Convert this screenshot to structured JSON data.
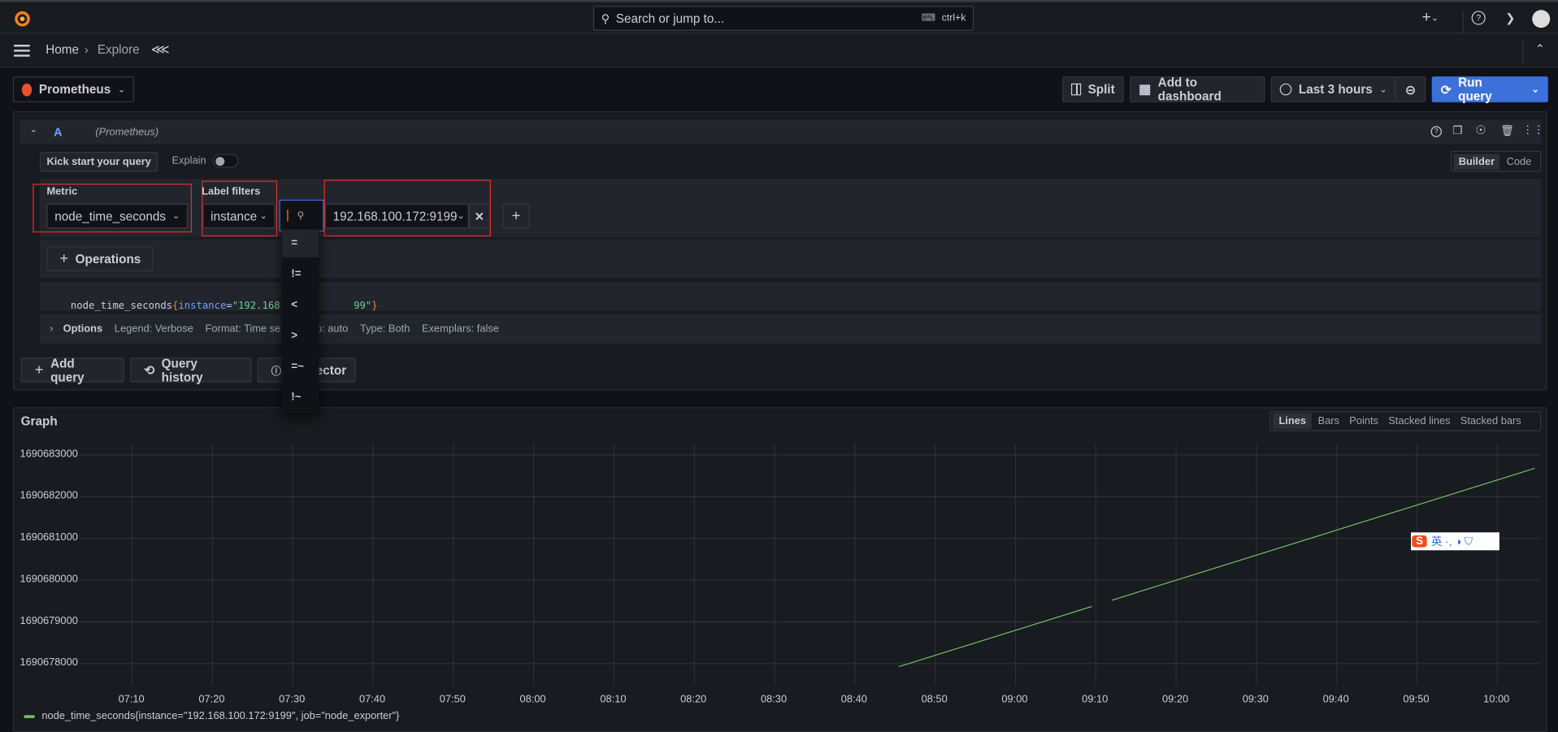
{
  "topbar": {
    "search_placeholder": "Search or jump to...",
    "search_shortcut": "ctrl+k"
  },
  "breadcrumb": {
    "home": "Home",
    "current": "Explore"
  },
  "toolbar": {
    "datasource": "Prometheus",
    "split": "Split",
    "add_to_dashboard": "Add to dashboard",
    "time_range": "Last 3 hours",
    "run_query": "Run query",
    "accent": "#3d71d9"
  },
  "query": {
    "ref_id": "A",
    "datasource_label": "(Prometheus)",
    "kick_start": "Kick start your query",
    "explain": "Explain",
    "explain_on": false,
    "modes": [
      "Builder",
      "Code"
    ],
    "active_mode": "Builder",
    "metric_label": "Metric",
    "metric_value": "node_time_seconds",
    "label_filters_label": "Label filters",
    "label_key": "instance",
    "label_value": "192.168.100.172:9199",
    "operations": "Operations",
    "preview": {
      "metric": "node_time_seconds",
      "open": "{",
      "key": "instance",
      "eq": "=",
      "value": "\"192.168.100.",
      "value_end": "99\"",
      "close": "}"
    },
    "options": {
      "title": "Options",
      "legend": "Legend: Verbose",
      "format": "Format: Time se",
      "step": "Step: auto",
      "type": "Type: Both",
      "exemplars": "Exemplars: false"
    }
  },
  "operator_dropdown": {
    "items": [
      "=",
      "!=",
      "<",
      ">",
      "=~",
      "!~"
    ],
    "highlighted": "="
  },
  "actions": {
    "add_query": "Add query",
    "query_history": "Query history",
    "inspector": "ector"
  },
  "graph": {
    "title": "Graph",
    "types": [
      "Lines",
      "Bars",
      "Points",
      "Stacked lines",
      "Stacked bars"
    ],
    "active_type": "Lines"
  },
  "chart_data": {
    "type": "line",
    "x_ticks": [
      "07:10",
      "07:20",
      "07:30",
      "07:40",
      "07:50",
      "08:00",
      "08:10",
      "08:20",
      "08:30",
      "08:40",
      "08:50",
      "09:00",
      "09:10",
      "09:20",
      "09:30",
      "09:40",
      "09:50",
      "10:00"
    ],
    "y_ticks": [
      "1690683000",
      "1690682000",
      "1690681000",
      "1690680000",
      "1690679000",
      "1690678000"
    ],
    "xlim": [
      "07:03:26",
      "10:05:20"
    ],
    "ylim": [
      1690677600,
      1690683120
    ],
    "grid": true,
    "legend_placement": "bottom-left",
    "series": [
      {
        "name": "node_time_seconds{instance=\"192.168.100.172:9199\", job=\"node_exporter\"}",
        "color": "#73bf69",
        "segments": [
          [
            [
              "08:45:29",
              1690677929
            ],
            [
              "09:09:30",
              1690679370
            ]
          ],
          [
            [
              "09:12:00",
              1690679520
            ],
            [
              "10:04:40",
              1690682680
            ]
          ]
        ]
      }
    ]
  },
  "watermark": {
    "text": "S 英 ·, ◑ 👕"
  }
}
